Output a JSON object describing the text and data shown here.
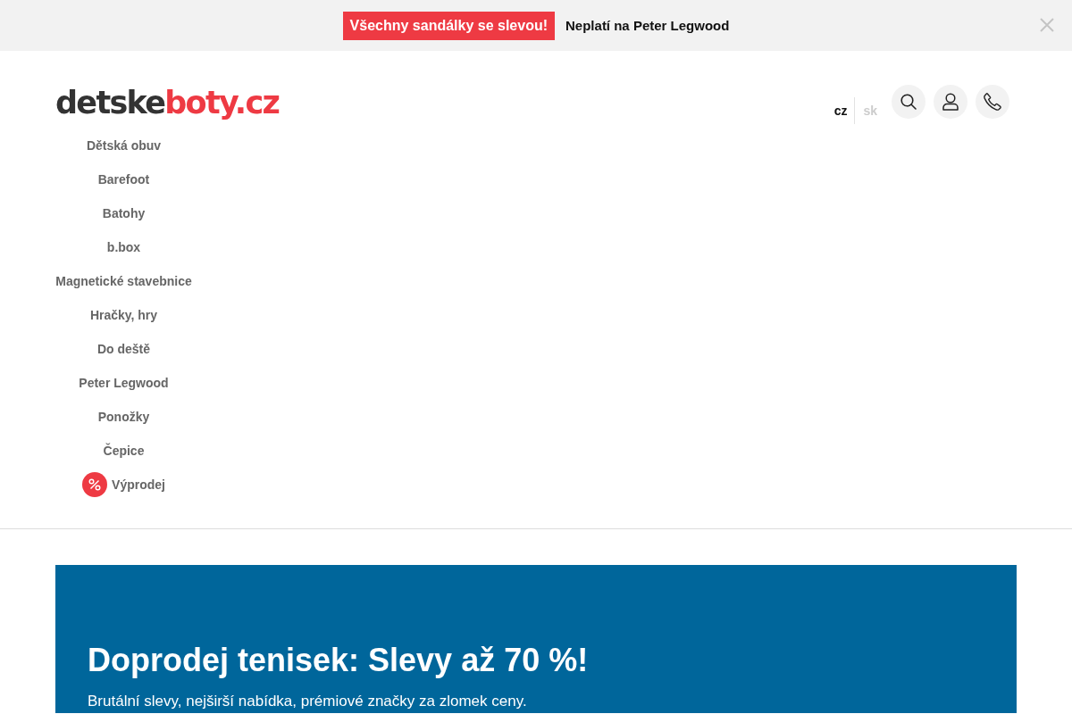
{
  "promo_bar": {
    "badge": "Všechny sandálky se slevou!",
    "note": "Neplatí na Peter Legwood"
  },
  "header": {
    "logo": {
      "dark": "detske",
      "accent": "boty.cz"
    },
    "languages": [
      {
        "label": "cz",
        "selected": true
      },
      {
        "label": "sk",
        "selected": false
      }
    ],
    "actions": [
      {
        "kind": "search"
      },
      {
        "kind": "account"
      },
      {
        "kind": "phone"
      }
    ]
  },
  "nav": {
    "items": [
      {
        "label": "Dětská obuv",
        "kind": "plain"
      },
      {
        "label": "Barefoot",
        "kind": "plain"
      },
      {
        "label": "Batohy",
        "kind": "plain"
      },
      {
        "label": "b.box",
        "kind": "plain"
      },
      {
        "label": "Magnetické stavebnice",
        "kind": "plain"
      },
      {
        "label": "Hračky, hry",
        "kind": "plain"
      },
      {
        "label": "Do deště",
        "kind": "plain"
      },
      {
        "label": "Peter Legwood",
        "kind": "plain"
      },
      {
        "label": "Ponožky",
        "kind": "plain"
      },
      {
        "label": "Čepice",
        "kind": "plain"
      },
      {
        "label": "Výprodej",
        "kind": "sale"
      }
    ]
  },
  "hero": {
    "title": "Doprodej tenisek: Slevy až 70 %!",
    "subtitle": "Brutální slevy, nejširší nabídka, prémiové značky za zlomek ceny."
  }
}
